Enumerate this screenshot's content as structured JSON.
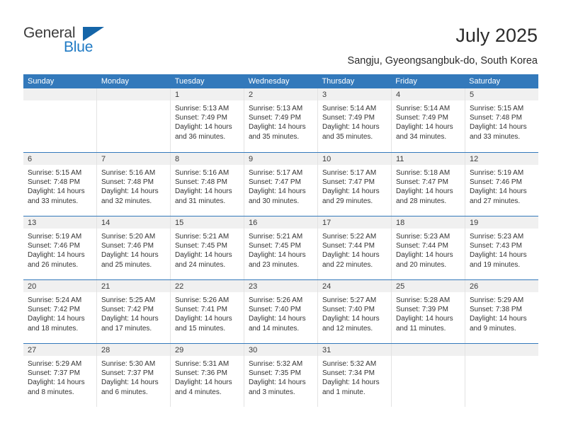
{
  "brand": {
    "name_part1": "General",
    "name_part2": "Blue",
    "triangle_icon": "blue-triangle-icon",
    "colors": {
      "dark": "#3b3b3b",
      "blue": "#1f7ac4",
      "triangle": "#1565a8"
    }
  },
  "header": {
    "title": "July 2025",
    "subtitle": "Sangju, Gyeongsangbuk-do, South Korea"
  },
  "calendar": {
    "header_bg": "#3379bb",
    "day_band_bg": "#f0f0f0",
    "weekdays": [
      "Sunday",
      "Monday",
      "Tuesday",
      "Wednesday",
      "Thursday",
      "Friday",
      "Saturday"
    ],
    "labels": {
      "sunrise": "Sunrise:",
      "sunset": "Sunset:",
      "daylight": "Daylight:"
    },
    "weeks": [
      [
        {
          "day": "",
          "empty": true
        },
        {
          "day": "",
          "empty": true
        },
        {
          "day": "1",
          "sunrise": "Sunrise: 5:13 AM",
          "sunset": "Sunset: 7:49 PM",
          "daylight": "Daylight: 14 hours and 36 minutes."
        },
        {
          "day": "2",
          "sunrise": "Sunrise: 5:13 AM",
          "sunset": "Sunset: 7:49 PM",
          "daylight": "Daylight: 14 hours and 35 minutes."
        },
        {
          "day": "3",
          "sunrise": "Sunrise: 5:14 AM",
          "sunset": "Sunset: 7:49 PM",
          "daylight": "Daylight: 14 hours and 35 minutes."
        },
        {
          "day": "4",
          "sunrise": "Sunrise: 5:14 AM",
          "sunset": "Sunset: 7:49 PM",
          "daylight": "Daylight: 14 hours and 34 minutes."
        },
        {
          "day": "5",
          "sunrise": "Sunrise: 5:15 AM",
          "sunset": "Sunset: 7:48 PM",
          "daylight": "Daylight: 14 hours and 33 minutes."
        }
      ],
      [
        {
          "day": "6",
          "sunrise": "Sunrise: 5:15 AM",
          "sunset": "Sunset: 7:48 PM",
          "daylight": "Daylight: 14 hours and 33 minutes."
        },
        {
          "day": "7",
          "sunrise": "Sunrise: 5:16 AM",
          "sunset": "Sunset: 7:48 PM",
          "daylight": "Daylight: 14 hours and 32 minutes."
        },
        {
          "day": "8",
          "sunrise": "Sunrise: 5:16 AM",
          "sunset": "Sunset: 7:48 PM",
          "daylight": "Daylight: 14 hours and 31 minutes."
        },
        {
          "day": "9",
          "sunrise": "Sunrise: 5:17 AM",
          "sunset": "Sunset: 7:47 PM",
          "daylight": "Daylight: 14 hours and 30 minutes."
        },
        {
          "day": "10",
          "sunrise": "Sunrise: 5:17 AM",
          "sunset": "Sunset: 7:47 PM",
          "daylight": "Daylight: 14 hours and 29 minutes."
        },
        {
          "day": "11",
          "sunrise": "Sunrise: 5:18 AM",
          "sunset": "Sunset: 7:47 PM",
          "daylight": "Daylight: 14 hours and 28 minutes."
        },
        {
          "day": "12",
          "sunrise": "Sunrise: 5:19 AM",
          "sunset": "Sunset: 7:46 PM",
          "daylight": "Daylight: 14 hours and 27 minutes."
        }
      ],
      [
        {
          "day": "13",
          "sunrise": "Sunrise: 5:19 AM",
          "sunset": "Sunset: 7:46 PM",
          "daylight": "Daylight: 14 hours and 26 minutes."
        },
        {
          "day": "14",
          "sunrise": "Sunrise: 5:20 AM",
          "sunset": "Sunset: 7:46 PM",
          "daylight": "Daylight: 14 hours and 25 minutes."
        },
        {
          "day": "15",
          "sunrise": "Sunrise: 5:21 AM",
          "sunset": "Sunset: 7:45 PM",
          "daylight": "Daylight: 14 hours and 24 minutes."
        },
        {
          "day": "16",
          "sunrise": "Sunrise: 5:21 AM",
          "sunset": "Sunset: 7:45 PM",
          "daylight": "Daylight: 14 hours and 23 minutes."
        },
        {
          "day": "17",
          "sunrise": "Sunrise: 5:22 AM",
          "sunset": "Sunset: 7:44 PM",
          "daylight": "Daylight: 14 hours and 22 minutes."
        },
        {
          "day": "18",
          "sunrise": "Sunrise: 5:23 AM",
          "sunset": "Sunset: 7:44 PM",
          "daylight": "Daylight: 14 hours and 20 minutes."
        },
        {
          "day": "19",
          "sunrise": "Sunrise: 5:23 AM",
          "sunset": "Sunset: 7:43 PM",
          "daylight": "Daylight: 14 hours and 19 minutes."
        }
      ],
      [
        {
          "day": "20",
          "sunrise": "Sunrise: 5:24 AM",
          "sunset": "Sunset: 7:42 PM",
          "daylight": "Daylight: 14 hours and 18 minutes."
        },
        {
          "day": "21",
          "sunrise": "Sunrise: 5:25 AM",
          "sunset": "Sunset: 7:42 PM",
          "daylight": "Daylight: 14 hours and 17 minutes."
        },
        {
          "day": "22",
          "sunrise": "Sunrise: 5:26 AM",
          "sunset": "Sunset: 7:41 PM",
          "daylight": "Daylight: 14 hours and 15 minutes."
        },
        {
          "day": "23",
          "sunrise": "Sunrise: 5:26 AM",
          "sunset": "Sunset: 7:40 PM",
          "daylight": "Daylight: 14 hours and 14 minutes."
        },
        {
          "day": "24",
          "sunrise": "Sunrise: 5:27 AM",
          "sunset": "Sunset: 7:40 PM",
          "daylight": "Daylight: 14 hours and 12 minutes."
        },
        {
          "day": "25",
          "sunrise": "Sunrise: 5:28 AM",
          "sunset": "Sunset: 7:39 PM",
          "daylight": "Daylight: 14 hours and 11 minutes."
        },
        {
          "day": "26",
          "sunrise": "Sunrise: 5:29 AM",
          "sunset": "Sunset: 7:38 PM",
          "daylight": "Daylight: 14 hours and 9 minutes."
        }
      ],
      [
        {
          "day": "27",
          "sunrise": "Sunrise: 5:29 AM",
          "sunset": "Sunset: 7:37 PM",
          "daylight": "Daylight: 14 hours and 8 minutes."
        },
        {
          "day": "28",
          "sunrise": "Sunrise: 5:30 AM",
          "sunset": "Sunset: 7:37 PM",
          "daylight": "Daylight: 14 hours and 6 minutes."
        },
        {
          "day": "29",
          "sunrise": "Sunrise: 5:31 AM",
          "sunset": "Sunset: 7:36 PM",
          "daylight": "Daylight: 14 hours and 4 minutes."
        },
        {
          "day": "30",
          "sunrise": "Sunrise: 5:32 AM",
          "sunset": "Sunset: 7:35 PM",
          "daylight": "Daylight: 14 hours and 3 minutes."
        },
        {
          "day": "31",
          "sunrise": "Sunrise: 5:32 AM",
          "sunset": "Sunset: 7:34 PM",
          "daylight": "Daylight: 14 hours and 1 minute."
        },
        {
          "day": "",
          "empty": true
        },
        {
          "day": "",
          "empty": true
        }
      ]
    ]
  }
}
